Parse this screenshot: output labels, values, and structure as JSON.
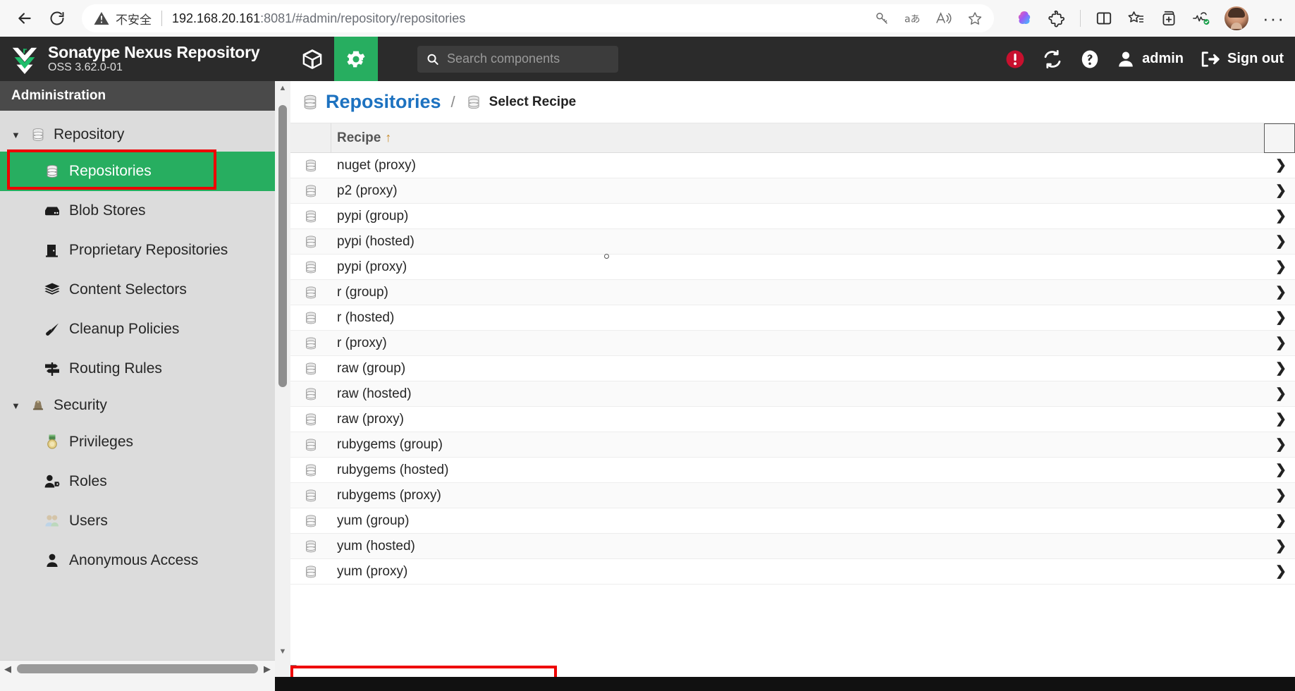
{
  "browser": {
    "back_label": "Back",
    "reload_label": "Reload",
    "security_warning": "不安全",
    "url_host": "192.168.20.161",
    "url_rest": ":8081/#admin/repository/repositories",
    "icons": {
      "back": "back-arrow-icon",
      "reload": "reload-icon",
      "warning": "warning-triangle-icon",
      "key": "key-icon",
      "translate": "translate-icon",
      "read_aloud": "read-aloud-icon",
      "favorite": "star-outline-icon",
      "copilot": "copilot-brain-icon",
      "extensions": "extensions-puzzle-icon",
      "split_screen": "split-screen-icon",
      "collections": "collections-star-icon",
      "add_tab_group": "add-to-collection-icon",
      "browser_essentials": "browser-essentials-icon",
      "profile": "profile-avatar",
      "settings_more": "more-ellipsis-icon"
    }
  },
  "nexus_header": {
    "product_name": "Sonatype Nexus Repository",
    "version": "OSS 3.62.0-01",
    "browse_icon": "cube-box-icon",
    "admin_icon": "gear-icon",
    "search": {
      "placeholder": "Search components",
      "value": ""
    },
    "alert_icon": "alert-circle-icon",
    "refresh_icon": "refresh-sync-icon",
    "help_icon": "question-circle-icon",
    "user_icon": "user-icon",
    "user_label": "admin",
    "signout_icon": "sign-out-icon",
    "signout_label": "Sign out",
    "accent_green": "#27ae60",
    "alert_red": "#c8102e"
  },
  "sidebar": {
    "title": "Administration",
    "groups": [
      {
        "label": "Repository",
        "icon": "database-icon",
        "expanded": true
      },
      {
        "label": "Security",
        "icon": "security-bell-icon",
        "expanded": true
      }
    ],
    "items": [
      {
        "label": "Repositories",
        "icon": "database-icon",
        "selected": true,
        "group": 0
      },
      {
        "label": "Blob Stores",
        "icon": "blob-store-icon",
        "selected": false,
        "group": 0
      },
      {
        "label": "Proprietary Repositories",
        "icon": "proprietary-icon",
        "selected": false,
        "group": 0
      },
      {
        "label": "Content Selectors",
        "icon": "layers-icon",
        "selected": false,
        "group": 0
      },
      {
        "label": "Cleanup Policies",
        "icon": "broom-icon",
        "selected": false,
        "group": 0
      },
      {
        "label": "Routing Rules",
        "icon": "signpost-icon",
        "selected": false,
        "group": 0
      },
      {
        "label": "Privileges",
        "icon": "medal-icon",
        "selected": false,
        "group": 1
      },
      {
        "label": "Roles",
        "icon": "user-tag-icon",
        "selected": false,
        "group": 1
      },
      {
        "label": "Users",
        "icon": "users-icon",
        "selected": false,
        "group": 1
      },
      {
        "label": "Anonymous Access",
        "icon": "anonymous-user-icon",
        "selected": false,
        "group": 1
      }
    ],
    "highlight_color": "#ee0000",
    "selected_bg": "#27ae60"
  },
  "breadcrumb": {
    "root_label": "Repositories",
    "root_icon": "database-icon",
    "separator": "/",
    "current_label": "Select Recipe",
    "current_icon": "database-icon"
  },
  "table": {
    "column_header": "Recipe",
    "sort_indicator": "↑",
    "chevron": "❯",
    "rows": [
      {
        "name": "nuget (proxy)",
        "icon": "database-icon"
      },
      {
        "name": "p2 (proxy)",
        "icon": "database-icon"
      },
      {
        "name": "pypi (group)",
        "icon": "database-icon"
      },
      {
        "name": "pypi (hosted)",
        "icon": "database-icon"
      },
      {
        "name": "pypi (proxy)",
        "icon": "database-icon"
      },
      {
        "name": "r (group)",
        "icon": "database-icon"
      },
      {
        "name": "r (hosted)",
        "icon": "database-icon"
      },
      {
        "name": "r (proxy)",
        "icon": "database-icon"
      },
      {
        "name": "raw (group)",
        "icon": "database-icon"
      },
      {
        "name": "raw (hosted)",
        "icon": "database-icon"
      },
      {
        "name": "raw (proxy)",
        "icon": "database-icon"
      },
      {
        "name": "rubygems (group)",
        "icon": "database-icon"
      },
      {
        "name": "rubygems (hosted)",
        "icon": "database-icon"
      },
      {
        "name": "rubygems (proxy)",
        "icon": "database-icon"
      },
      {
        "name": "yum (group)",
        "icon": "database-icon"
      },
      {
        "name": "yum (hosted)",
        "icon": "database-icon"
      },
      {
        "name": "yum (proxy)",
        "icon": "database-icon",
        "highlighted": true
      }
    ]
  }
}
